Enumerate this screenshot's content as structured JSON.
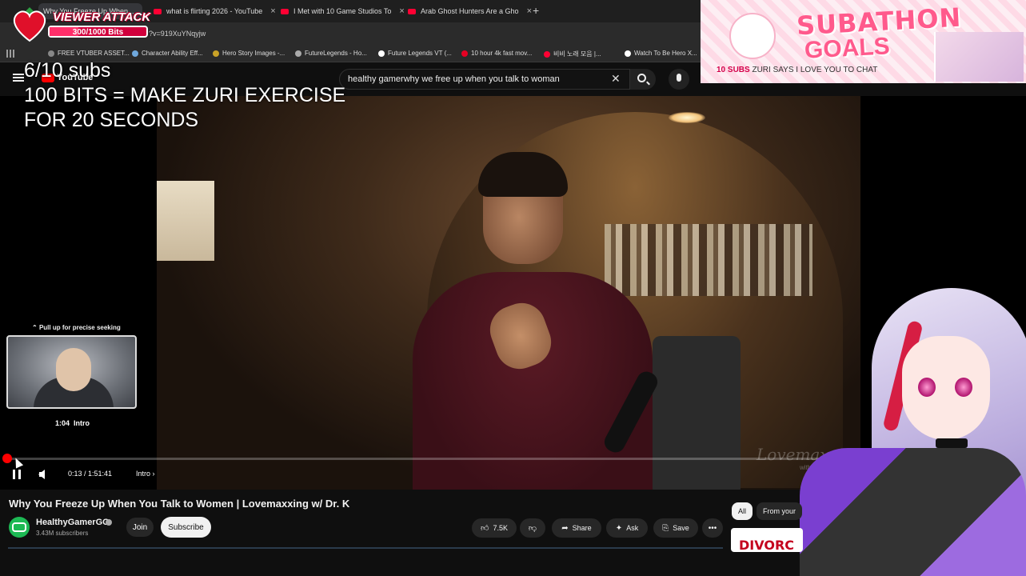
{
  "browser": {
    "tabs": [
      {
        "title": "Why You Freeze Up When...",
        "active": true
      },
      {
        "title": "what is flirting 2026 - YouTube"
      },
      {
        "title": "I Met with 10 Game Studios To"
      },
      {
        "title": "Arab Ghost Hunters Are a Gho"
      }
    ],
    "url": "?v=919XuYNqyjw",
    "bookmarks": [
      "FREE VTUBER ASSET...",
      "Character Ability Eff...",
      "Hero Story Images -...",
      "FutureLegends - Ho...",
      "Future Legends VT (...",
      "10 hour 4k fast mov...",
      "비비 노래 모음 |...",
      "Watch To Be Hero X..."
    ]
  },
  "youtube": {
    "logo": "YouTube",
    "search_value": "healthy gamerwhy we free up when you talk to woman"
  },
  "overlays": {
    "subs_goal": "6/10 subs",
    "bits_goal": "100 BITS = MAKE ZURI EXERCISE FOR 20 SECONDS",
    "viewer_attack": {
      "title": "VIEWER ATTACK",
      "count": "300/1000 Bits",
      "progress": 0.3
    },
    "subathon": {
      "title": "SUBATHON",
      "subtitle": "GOALS",
      "goal_bold": "10 SUBS",
      "goal_text": "ZURI SAYS I LOVE YOU TO CHAT"
    },
    "watermark": "Lovemaxxing",
    "watermark_sub": "with Dr. K"
  },
  "player": {
    "pull_up_hint": "Pull up for precise seeking",
    "preview_time": "1:04",
    "preview_chapter": "Intro",
    "time": "0:13 / 1:51:41",
    "chapter": "Intro",
    "progress": 0.002
  },
  "video": {
    "title": "Why You Freeze Up When You Talk to Women | Lovemaxxing w/ Dr. K",
    "channel": "HealthyGamerGG",
    "subscribers": "3.43M subscribers",
    "join": "Join",
    "subscribe": "Subscribe",
    "likes": "7.5K",
    "share": "Share",
    "ask": "Ask",
    "save": "Save"
  },
  "recommendations": {
    "chips": [
      "All",
      "From your"
    ],
    "thumb_text": "DIVORC"
  },
  "colors": {
    "accent": "#ff0000",
    "subathon_pink": "#ff5a8c"
  }
}
